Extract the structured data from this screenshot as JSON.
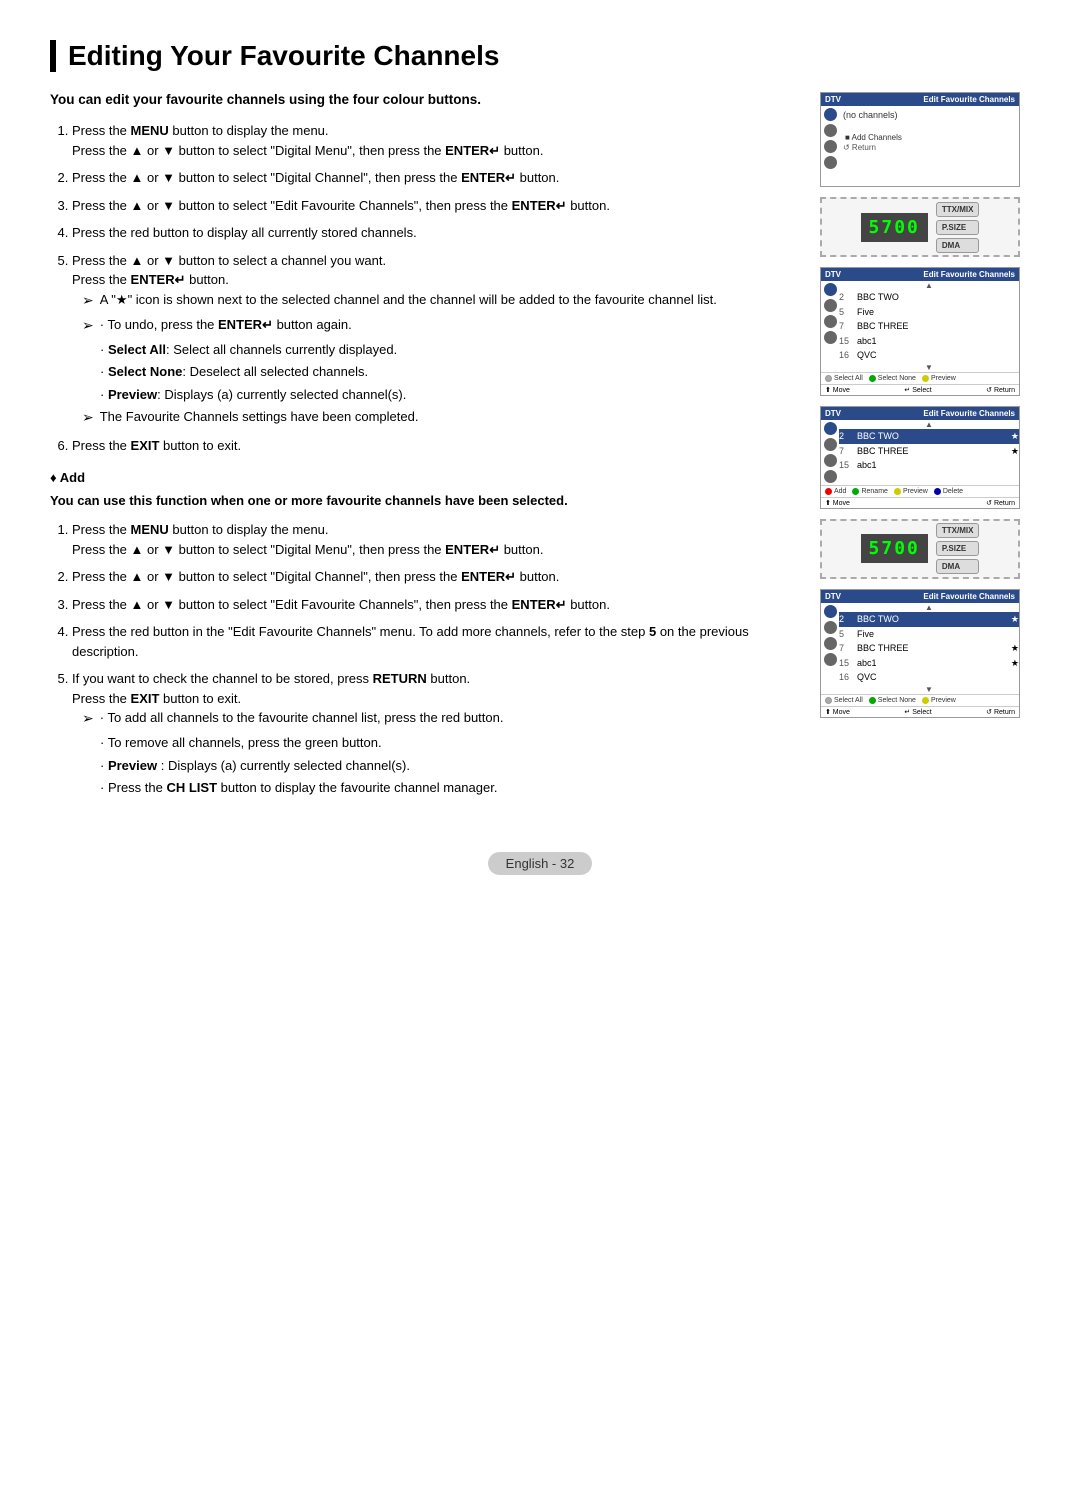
{
  "page": {
    "title": "Editing Your Favourite Channels",
    "footer": "English - 32"
  },
  "intro": {
    "text": "You can edit your favourite channels using the four colour buttons."
  },
  "section1": {
    "steps": [
      {
        "id": 1,
        "main": "Press the MENU button to display the menu.",
        "sub": "Press the ▲ or ▼ button to select \"Digital Menu\", then press the ENTER↵ button."
      },
      {
        "id": 2,
        "main": "Press the ▲ or ▼ button to select \"Digital Channel\", then press the ENTER↵ button."
      },
      {
        "id": 3,
        "main": "Press the ▲ or ▼ button to select \"Edit Favourite Channels\", then press the ENTER↵ button."
      },
      {
        "id": 4,
        "main": "Press the red button to display all currently stored channels."
      },
      {
        "id": 5,
        "main": "Press the ▲ or ▼ button to select a channel you want. Press the ENTER↵ button."
      }
    ],
    "arrows": [
      "A \"★\" icon is shown next to the selected channel and the channel will be added to the favourite channel list.",
      "• To undo, press the ENTER↵ button again."
    ],
    "bullets": [
      {
        "label": "Select All",
        "text": "Select all channels currently displayed."
      },
      {
        "label": "Select None",
        "text": "Deselect all selected channels."
      },
      {
        "label": "Preview",
        "text": "Displays (a) currently selected channel(s)."
      }
    ],
    "arrow2": "The Favourite Channels settings have been completed.",
    "step6": "Press the EXIT button to exit."
  },
  "section_add": {
    "header": "♦ Add",
    "intro": "You can use this function when one or more favourite channels have been selected.",
    "steps": [
      {
        "id": 1,
        "main": "Press the MENU button to display the menu.",
        "sub": "Press the ▲ or ▼ button to select \"Digital Menu\", then press the ENTER↵ button."
      },
      {
        "id": 2,
        "main": "Press the ▲ or ▼ button to select \"Digital Channel\", then press the ENTER↵ button."
      },
      {
        "id": 3,
        "main": "Press the ▲ or ▼ button to select \"Edit Favourite Channels\", then press the ENTER↵ button."
      },
      {
        "id": 4,
        "main": "Press the red button in the \"Edit Favourite Channels\" menu. To add more channels, refer to the step 5 on the previous description."
      },
      {
        "id": 5,
        "main": "If you want to check the channel to be stored, press RETURN button.",
        "sub2": "Press the EXIT button to exit."
      }
    ],
    "arrows": [
      "• To add all channels to the favourite channel list, press the red button.",
      "• To remove all channels, press the green button.",
      "• Preview : Displays (a) currently selected channel(s).",
      "• Press the CH LIST button to display the favourite channel manager."
    ]
  },
  "screens": {
    "screen1": {
      "header_left": "DTV",
      "header_right": "Edit Favourite Channels",
      "no_channels": "(no channels)",
      "add_btn": "Add Channels",
      "return_btn": "↺ Return",
      "icons": [
        "circle",
        "circle",
        "circle",
        "circle"
      ]
    },
    "remote1": {
      "display": "5700",
      "buttons": [
        "TTX/MIX",
        "P.SIZE",
        "DMA"
      ]
    },
    "screen2": {
      "header_left": "DTV",
      "header_right": "Edit Favourite Channels",
      "up": "▲",
      "channels": [
        {
          "num": "2",
          "name": "BBC TWO",
          "star": ""
        },
        {
          "num": "5",
          "name": "Five",
          "star": ""
        },
        {
          "num": "7",
          "name": "BBC THREE",
          "star": ""
        },
        {
          "num": "15",
          "name": "abc1",
          "star": ""
        },
        {
          "num": "16",
          "name": "QVC",
          "star": ""
        }
      ],
      "down": "▼",
      "footer": [
        {
          "color": "white",
          "label": "Select All"
        },
        {
          "color": "green",
          "label": "Select None"
        },
        {
          "color": "yellow",
          "label": "Preview"
        }
      ],
      "move": "⬆ Move",
      "select": "↵ Select",
      "return": "↺ Return"
    },
    "screen3": {
      "header_left": "DTV",
      "header_right": "Edit Favourite Channels",
      "up": "▲",
      "channels": [
        {
          "num": "2",
          "name": "BBC TWO",
          "star": "★",
          "selected": true
        },
        {
          "num": "7",
          "name": "BBC THREE",
          "star": "★"
        },
        {
          "num": "15",
          "name": "abc1",
          "star": ""
        }
      ],
      "footer": [
        {
          "color": "red",
          "label": "Add"
        },
        {
          "color": "green",
          "label": "Rename"
        },
        {
          "color": "yellow",
          "label": "Preview"
        },
        {
          "color": "blue",
          "label": "Delete"
        }
      ],
      "move": "⬆ Move",
      "return": "↺ Return"
    },
    "remote2": {
      "display": "5700",
      "buttons": [
        "TTX/MIX",
        "P.SIZE",
        "DMA"
      ]
    },
    "screen4": {
      "header_left": "DTV",
      "header_right": "Edit Favourite Channels",
      "up": "▲",
      "channels": [
        {
          "num": "2",
          "name": "BBC TWO",
          "star": "★",
          "selected": true
        },
        {
          "num": "5",
          "name": "Five",
          "star": ""
        },
        {
          "num": "7",
          "name": "BBC THREE",
          "star": "★"
        },
        {
          "num": "15",
          "name": "abc1",
          "star": "★"
        },
        {
          "num": "16",
          "name": "QVC",
          "star": ""
        }
      ],
      "down": "▼",
      "footer": [
        {
          "color": "white",
          "label": "Select All"
        },
        {
          "color": "green",
          "label": "Select None"
        },
        {
          "color": "yellow",
          "label": "Preview"
        }
      ],
      "move": "⬆ Move",
      "select": "↵ Select",
      "return": "↺ Return"
    }
  }
}
